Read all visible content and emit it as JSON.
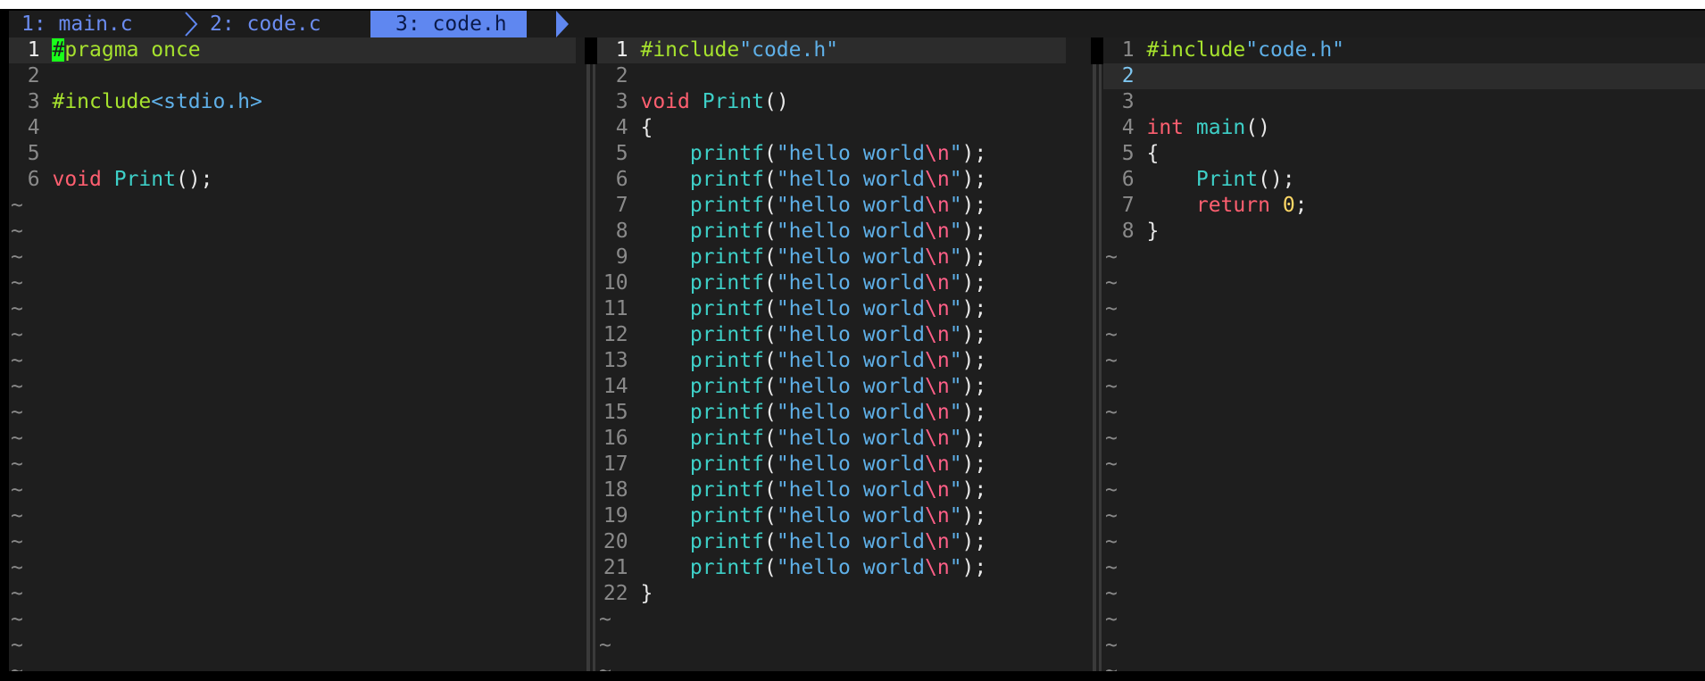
{
  "tabs": [
    {
      "label": "1: main.c",
      "active": false
    },
    {
      "label": "2: code.c",
      "active": false
    },
    {
      "label": "3: code.h",
      "active": true
    }
  ],
  "pane_left": {
    "file": "code.h",
    "lines": [
      {
        "n": "1",
        "text": "#pragma once",
        "current": true
      },
      {
        "n": "2",
        "text": ""
      },
      {
        "n": "3",
        "text": "#include<stdio.h>"
      },
      {
        "n": "4",
        "text": ""
      },
      {
        "n": "5",
        "text": ""
      },
      {
        "n": "6",
        "text": "void Print();"
      }
    ],
    "tilde": "~"
  },
  "pane_middle": {
    "file": "code.c",
    "lines": [
      {
        "n": "1",
        "text": "#include\"code.h\"",
        "current": true
      },
      {
        "n": "2",
        "text": ""
      },
      {
        "n": "3",
        "text": "void Print()"
      },
      {
        "n": "4",
        "text": "{"
      },
      {
        "n": "5",
        "text": "    printf(\"hello world\\n\");"
      },
      {
        "n": "6",
        "text": "    printf(\"hello world\\n\");"
      },
      {
        "n": "7",
        "text": "    printf(\"hello world\\n\");"
      },
      {
        "n": "8",
        "text": "    printf(\"hello world\\n\");"
      },
      {
        "n": "9",
        "text": "    printf(\"hello world\\n\");"
      },
      {
        "n": "10",
        "text": "    printf(\"hello world\\n\");"
      },
      {
        "n": "11",
        "text": "    printf(\"hello world\\n\");"
      },
      {
        "n": "12",
        "text": "    printf(\"hello world\\n\");"
      },
      {
        "n": "13",
        "text": "    printf(\"hello world\\n\");"
      },
      {
        "n": "14",
        "text": "    printf(\"hello world\\n\");"
      },
      {
        "n": "15",
        "text": "    printf(\"hello world\\n\");"
      },
      {
        "n": "16",
        "text": "    printf(\"hello world\\n\");"
      },
      {
        "n": "17",
        "text": "    printf(\"hello world\\n\");"
      },
      {
        "n": "18",
        "text": "    printf(\"hello world\\n\");"
      },
      {
        "n": "19",
        "text": "    printf(\"hello world\\n\");"
      },
      {
        "n": "20",
        "text": "    printf(\"hello world\\n\");"
      },
      {
        "n": "21",
        "text": "    printf(\"hello world\\n\");"
      },
      {
        "n": "22",
        "text": "}"
      }
    ],
    "tilde": "~"
  },
  "pane_right": {
    "file": "main.c",
    "lines": [
      {
        "n": "1",
        "text": "#include\"code.h\""
      },
      {
        "n": "2",
        "text": "",
        "current": true
      },
      {
        "n": "3",
        "text": ""
      },
      {
        "n": "4",
        "text": "int main()"
      },
      {
        "n": "5",
        "text": "{"
      },
      {
        "n": "6",
        "text": "    Print();"
      },
      {
        "n": "7",
        "text": "    return 0;"
      },
      {
        "n": "8",
        "text": "}"
      }
    ],
    "tilde": "~"
  },
  "colors": {
    "background": "#1e1e1e",
    "tab_active": "#5f87f0",
    "preprocessor": "#a6e22e",
    "string": "#5fb0e8",
    "keyword": "#ff5f70",
    "function": "#3ed0c8",
    "cursor": "#1aff1a"
  }
}
